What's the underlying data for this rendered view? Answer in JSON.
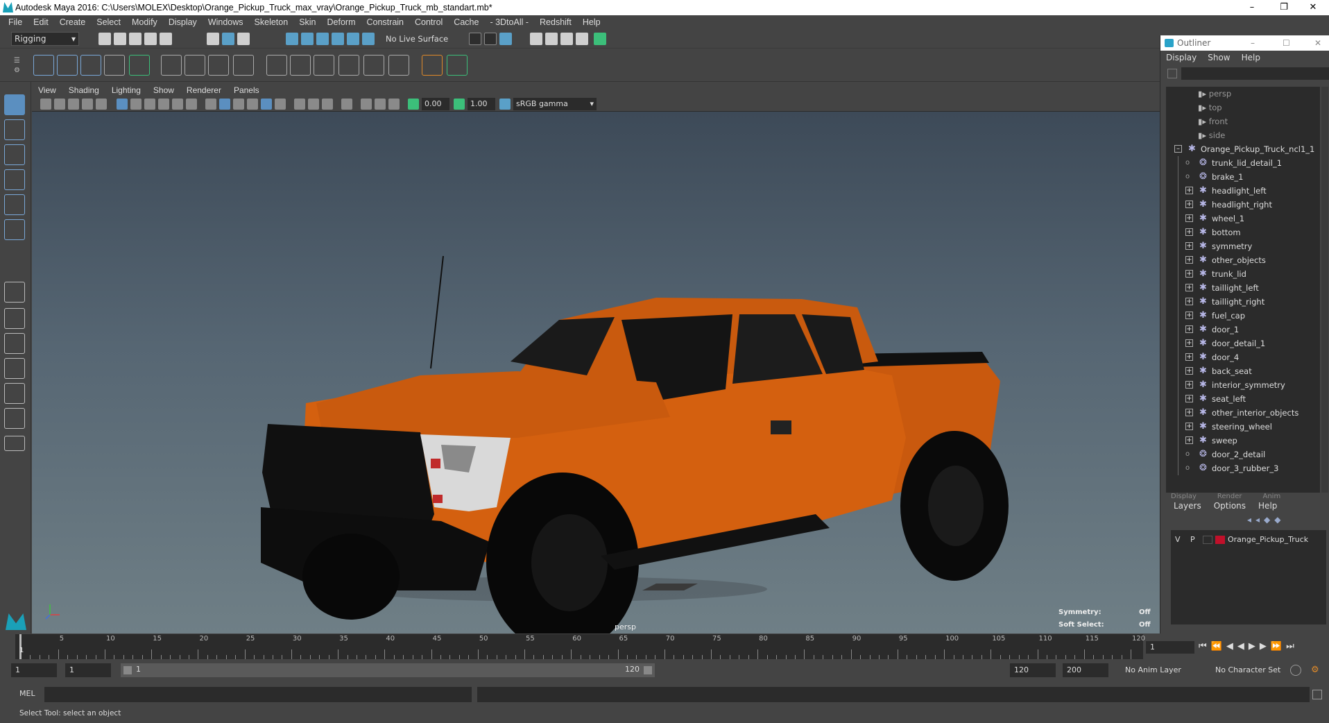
{
  "window": {
    "title": "Autodesk Maya 2016: C:\\Users\\MOLEX\\Desktop\\Orange_Pickup_Truck_max_vray\\Orange_Pickup_Truck_mb_standart.mb*"
  },
  "menubar": [
    "File",
    "Edit",
    "Create",
    "Select",
    "Modify",
    "Display",
    "Windows",
    "Skeleton",
    "Skin",
    "Deform",
    "Constrain",
    "Control",
    "Cache",
    "- 3DtoAll -",
    "Redshift",
    "Help"
  ],
  "statusline": {
    "mode": "Rigging",
    "live_surface": "No Live Surface"
  },
  "panel_menu": [
    "View",
    "Shading",
    "Lighting",
    "Show",
    "Renderer",
    "Panels"
  ],
  "panel_toolbar": {
    "exposure": "0.00",
    "gamma": "1.00",
    "color_space": "sRGB gamma"
  },
  "viewport": {
    "camera_label": "persp",
    "symmetry_label": "Symmetry:",
    "symmetry_value": "Off",
    "soft_select_label": "Soft Select:",
    "soft_select_value": "Off"
  },
  "outliner": {
    "title": "Outliner",
    "menu": [
      "Display",
      "Show",
      "Help"
    ],
    "cameras": [
      "persp",
      "top",
      "front",
      "side"
    ],
    "root": "Orange_Pickup_Truck_ncl1_1",
    "children": [
      {
        "name": "trunk_lid_detail_1",
        "expand": false
      },
      {
        "name": "brake_1",
        "expand": false
      },
      {
        "name": "headlight_left",
        "expand": true
      },
      {
        "name": "headlight_right",
        "expand": true
      },
      {
        "name": "wheel_1",
        "expand": true
      },
      {
        "name": "bottom",
        "expand": true
      },
      {
        "name": "symmetry",
        "expand": true
      },
      {
        "name": "other_objects",
        "expand": true
      },
      {
        "name": "trunk_lid",
        "expand": true
      },
      {
        "name": "taillight_left",
        "expand": true
      },
      {
        "name": "taillight_right",
        "expand": true
      },
      {
        "name": "fuel_cap",
        "expand": true
      },
      {
        "name": "door_1",
        "expand": true
      },
      {
        "name": "door_detail_1",
        "expand": true
      },
      {
        "name": "door_4",
        "expand": true
      },
      {
        "name": "back_seat",
        "expand": true
      },
      {
        "name": "interior_symmetry",
        "expand": true
      },
      {
        "name": "seat_left",
        "expand": true
      },
      {
        "name": "other_interior_objects",
        "expand": true
      },
      {
        "name": "steering_wheel",
        "expand": true
      },
      {
        "name": "sweep",
        "expand": true
      },
      {
        "name": "door_2_detail",
        "expand": false
      },
      {
        "name": "door_3_rubber_3",
        "expand": false
      }
    ]
  },
  "layers": {
    "tabs": [
      "Display",
      "Render",
      "Anim"
    ],
    "menu": [
      "Layers",
      "Options",
      "Help"
    ],
    "layer": {
      "v": "V",
      "p": "P",
      "name": "Orange_Pickup_Truck",
      "color": "#c0102a"
    }
  },
  "timeslider": {
    "ticks": [
      "5",
      "10",
      "15",
      "20",
      "25",
      "30",
      "35",
      "40",
      "45",
      "50",
      "55",
      "60",
      "65",
      "70",
      "75",
      "80",
      "85",
      "90",
      "95",
      "100",
      "105",
      "110",
      "115",
      "120"
    ],
    "current_frame_marker": "1",
    "current_frame": "1"
  },
  "rangeslider": {
    "start": "1",
    "start_inner": "1",
    "range_start": "1",
    "range_end": "120",
    "end_inner": "120",
    "end": "200",
    "anim_layer": "No Anim Layer",
    "character_set": "No Character Set"
  },
  "cmdline": {
    "label": "MEL"
  },
  "helpline": {
    "text": "Select Tool: select an object"
  },
  "colors": {
    "truck_body": "#d4600f",
    "viewport_top": "#3d4a58",
    "viewport_bottom": "#6f7f86",
    "accent_green": "#3cbf7a"
  }
}
